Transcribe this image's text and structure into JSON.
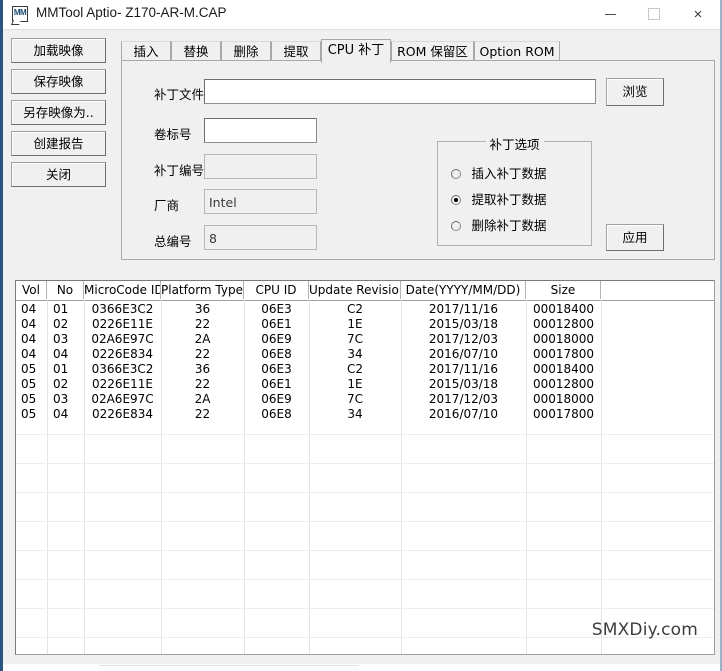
{
  "window": {
    "title": "MMTool Aptio- Z170-AR-M.CAP",
    "icon": "mmtool-icon",
    "icon_label": "MM",
    "minimize_label": "minimize",
    "maximize_label": "maximize",
    "close_label": "×"
  },
  "sidebar": {
    "items": [
      {
        "label": "加载映像",
        "name": "load-image-button"
      },
      {
        "label": "保存映像",
        "name": "save-image-button"
      },
      {
        "label": "另存映像为..",
        "name": "save-image-as-button"
      },
      {
        "label": "创建报告",
        "name": "create-report-button"
      },
      {
        "label": "关闭",
        "name": "close-button"
      }
    ]
  },
  "tabs": [
    {
      "label": "插入",
      "selected": false
    },
    {
      "label": "替换",
      "selected": false
    },
    {
      "label": "删除",
      "selected": false
    },
    {
      "label": "提取",
      "selected": false
    },
    {
      "label": "CPU 补丁",
      "selected": true
    },
    {
      "label": "ROM 保留区",
      "selected": false
    },
    {
      "label": "Option ROM",
      "selected": false
    }
  ],
  "form": {
    "patch_file": {
      "label": "补丁文件",
      "value": "",
      "placeholder": "",
      "enabled": true
    },
    "volume_label": {
      "label": "卷标号",
      "value": "",
      "placeholder": "",
      "enabled": true
    },
    "patch_number": {
      "label": "补丁编号",
      "value": "",
      "placeholder": "",
      "enabled": false
    },
    "vendor": {
      "label": "厂商",
      "value": "Intel",
      "enabled": false
    },
    "total_number": {
      "label": "总编号",
      "value": "8",
      "enabled": false
    },
    "browse_button": "浏览",
    "apply_button": "应用"
  },
  "options_group": {
    "title": "补丁选项",
    "options": [
      {
        "label": "插入补丁数据",
        "selected": false
      },
      {
        "label": "提取补丁数据",
        "selected": true
      },
      {
        "label": "删除补丁数据",
        "selected": false
      }
    ]
  },
  "grid": {
    "columns": [
      "Vol",
      "No",
      "MicroCode ID",
      "Platform Type",
      "CPU ID",
      "Update Revision",
      "Date(YYYY/MM/DD)",
      "Size",
      ""
    ],
    "rows": [
      [
        "04",
        "01",
        "0366E3C2",
        "36",
        "06E3",
        "C2",
        "2017/11/16",
        "00018400",
        ""
      ],
      [
        "04",
        "02",
        "0226E11E",
        "22",
        "06E1",
        "1E",
        "2015/03/18",
        "00012800",
        ""
      ],
      [
        "04",
        "03",
        "02A6E97C",
        "2A",
        "06E9",
        "7C",
        "2017/12/03",
        "00018000",
        ""
      ],
      [
        "04",
        "04",
        "0226E834",
        "22",
        "06E8",
        "34",
        "2016/07/10",
        "00017800",
        ""
      ],
      [
        "05",
        "01",
        "0366E3C2",
        "36",
        "06E3",
        "C2",
        "2017/11/16",
        "00018400",
        ""
      ],
      [
        "05",
        "02",
        "0226E11E",
        "22",
        "06E1",
        "1E",
        "2015/03/18",
        "00012800",
        ""
      ],
      [
        "05",
        "03",
        "02A6E97C",
        "2A",
        "06E9",
        "7C",
        "2017/12/03",
        "00018000",
        ""
      ],
      [
        "05",
        "04",
        "0226E834",
        "22",
        "06E8",
        "34",
        "2016/07/10",
        "00017800",
        ""
      ]
    ]
  },
  "watermark": "SMXDiy.com",
  "colors": {
    "window_border": "#2a5580",
    "panel_bg": "#f0f0f0",
    "field_bg": "#ffffff",
    "field_disabled_bg": "#f0f0f0",
    "text": "#000000",
    "grid_line": "#e4e4e4"
  }
}
